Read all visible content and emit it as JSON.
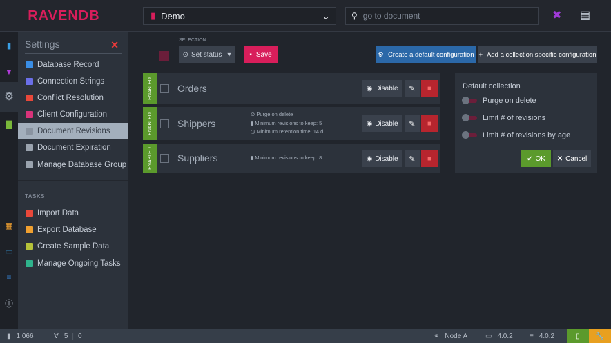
{
  "app": {
    "logo": "RAVENDB"
  },
  "header": {
    "database": "Demo",
    "search_placeholder": "go to document"
  },
  "settings": {
    "title": "Settings",
    "items": [
      {
        "label": "Database Record",
        "color": "#3a8ee6"
      },
      {
        "label": "Connection Strings",
        "color": "#6b6fe8"
      },
      {
        "label": "Conflict Resolution",
        "color": "#e8483a"
      },
      {
        "label": "Client Configuration",
        "color": "#d8337a"
      },
      {
        "label": "Document Revisions",
        "color": "#8a94a1"
      },
      {
        "label": "Document Expiration",
        "color": "#9aa3ae"
      },
      {
        "label": "Manage Database Group",
        "color": "#9aa3ae"
      }
    ],
    "tasks_header": "TASKS",
    "tasks": [
      {
        "label": "Import Data",
        "color": "#e8483a"
      },
      {
        "label": "Export Database",
        "color": "#f0a030"
      },
      {
        "label": "Create Sample Data",
        "color": "#b5c23a"
      },
      {
        "label": "Manage Ongoing Tasks",
        "color": "#2fb38c"
      }
    ]
  },
  "toolbar": {
    "selection_label": "SELECTION",
    "set_status": "Set status",
    "save": "Save",
    "create_default": "Create a default configuration",
    "add_collection": "Add a collection specific configuration"
  },
  "collections": [
    {
      "status": "ENABLED",
      "name": "Orders",
      "info": [],
      "disable": "Disable"
    },
    {
      "status": "ENABLED",
      "name": "Shippers",
      "info": [
        "Purge on delete",
        "Minimum revisions to keep: 5",
        "Minimum retention time: 14 d"
      ],
      "disable": "Disable"
    },
    {
      "status": "ENABLED",
      "name": "Suppliers",
      "info": [
        "Minimum revisions to keep: 8"
      ],
      "disable": "Disable"
    }
  ],
  "default_panel": {
    "title": "Default collection",
    "toggles": [
      "Purge on delete",
      "Limit # of revisions",
      "Limit # of revisions by age"
    ],
    "ok": "OK",
    "cancel": "Cancel"
  },
  "status_bar": {
    "documents": "1,066",
    "indexes": "5",
    "errors": "0",
    "node": "Node A",
    "client_version": "4.0.2",
    "server_version": "4.0.2"
  }
}
